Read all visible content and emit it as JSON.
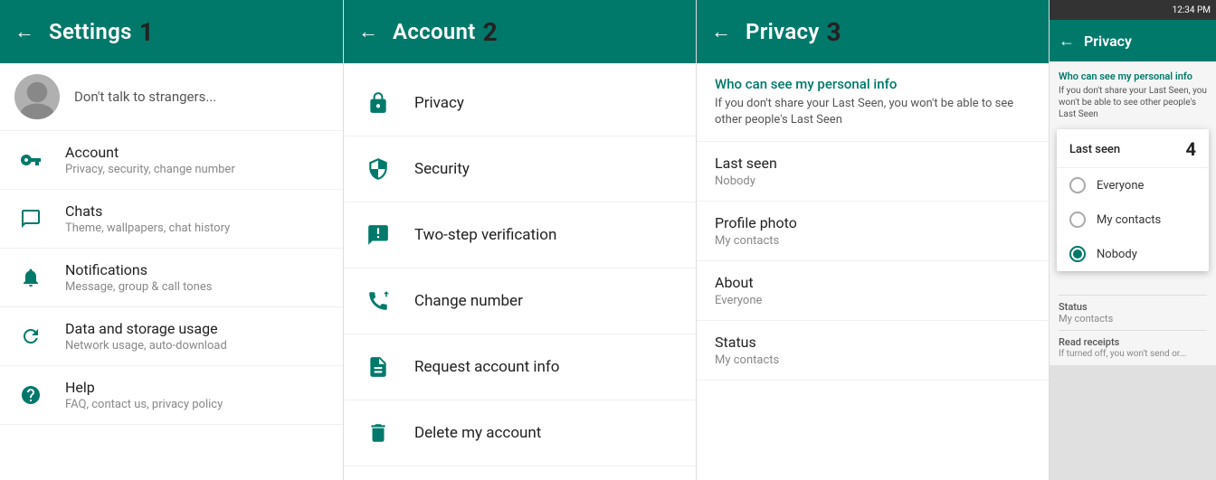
{
  "panel1": {
    "header": {
      "title": "Settings",
      "number": "1",
      "back_label": "←"
    },
    "profile": {
      "name": "Don't talk to strangers..."
    },
    "items": [
      {
        "id": "account",
        "title": "Account",
        "subtitle": "Privacy, security, change number",
        "icon": "key-icon"
      },
      {
        "id": "chats",
        "title": "Chats",
        "subtitle": "Theme, wallpapers, chat history",
        "icon": "chat-icon"
      },
      {
        "id": "notifications",
        "title": "Notifications",
        "subtitle": "Message, group & call tones",
        "icon": "bell-icon"
      },
      {
        "id": "data",
        "title": "Data and storage usage",
        "subtitle": "Network usage, auto-download",
        "icon": "refresh-icon"
      },
      {
        "id": "help",
        "title": "Help",
        "subtitle": "FAQ, contact us, privacy policy",
        "icon": "help-icon"
      }
    ]
  },
  "panel2": {
    "header": {
      "title": "Account",
      "number": "2",
      "back_label": "←"
    },
    "items": [
      {
        "id": "privacy",
        "label": "Privacy",
        "icon": "lock-icon"
      },
      {
        "id": "security",
        "label": "Security",
        "icon": "shield-icon"
      },
      {
        "id": "two-step",
        "label": "Two-step verification",
        "icon": "dots-icon"
      },
      {
        "id": "change-number",
        "label": "Change number",
        "icon": "phone-edit-icon"
      },
      {
        "id": "request-info",
        "label": "Request account info",
        "icon": "doc-icon"
      },
      {
        "id": "delete",
        "label": "Delete my account",
        "icon": "trash-icon"
      }
    ]
  },
  "panel3": {
    "header": {
      "title": "Privacy",
      "number": "3",
      "back_label": "←"
    },
    "info": {
      "title": "Who can see my personal info",
      "text": "If you don't share your Last Seen, you won't be able to see other people's Last Seen"
    },
    "items": [
      {
        "id": "last-seen",
        "label": "Last seen",
        "value": "Nobody"
      },
      {
        "id": "profile-photo",
        "label": "Profile photo",
        "value": "My contacts"
      },
      {
        "id": "about",
        "label": "About",
        "value": "Everyone"
      },
      {
        "id": "status",
        "label": "Status",
        "value": "My contacts"
      }
    ]
  },
  "panel4": {
    "status_bar": "12:34 PM",
    "header": {
      "title": "Privacy",
      "back_label": "←"
    },
    "top_info": {
      "title": "Who can see my personal info",
      "text": "If you don't share your Last Seen, you won't be able to see other people's Last Seen"
    },
    "dialog": {
      "number": "4",
      "title": "Last seen",
      "options": [
        {
          "id": "everyone",
          "label": "Everyone",
          "selected": false
        },
        {
          "id": "my-contacts",
          "label": "My contacts",
          "selected": false
        },
        {
          "id": "nobody",
          "label": "Nobody",
          "selected": true
        }
      ]
    },
    "bottom_items": [
      {
        "id": "status",
        "label": "Status",
        "value": "My contacts"
      },
      {
        "id": "read-receipts",
        "label": "Read receipts",
        "note": "If turned off, you won't send or..."
      }
    ]
  }
}
